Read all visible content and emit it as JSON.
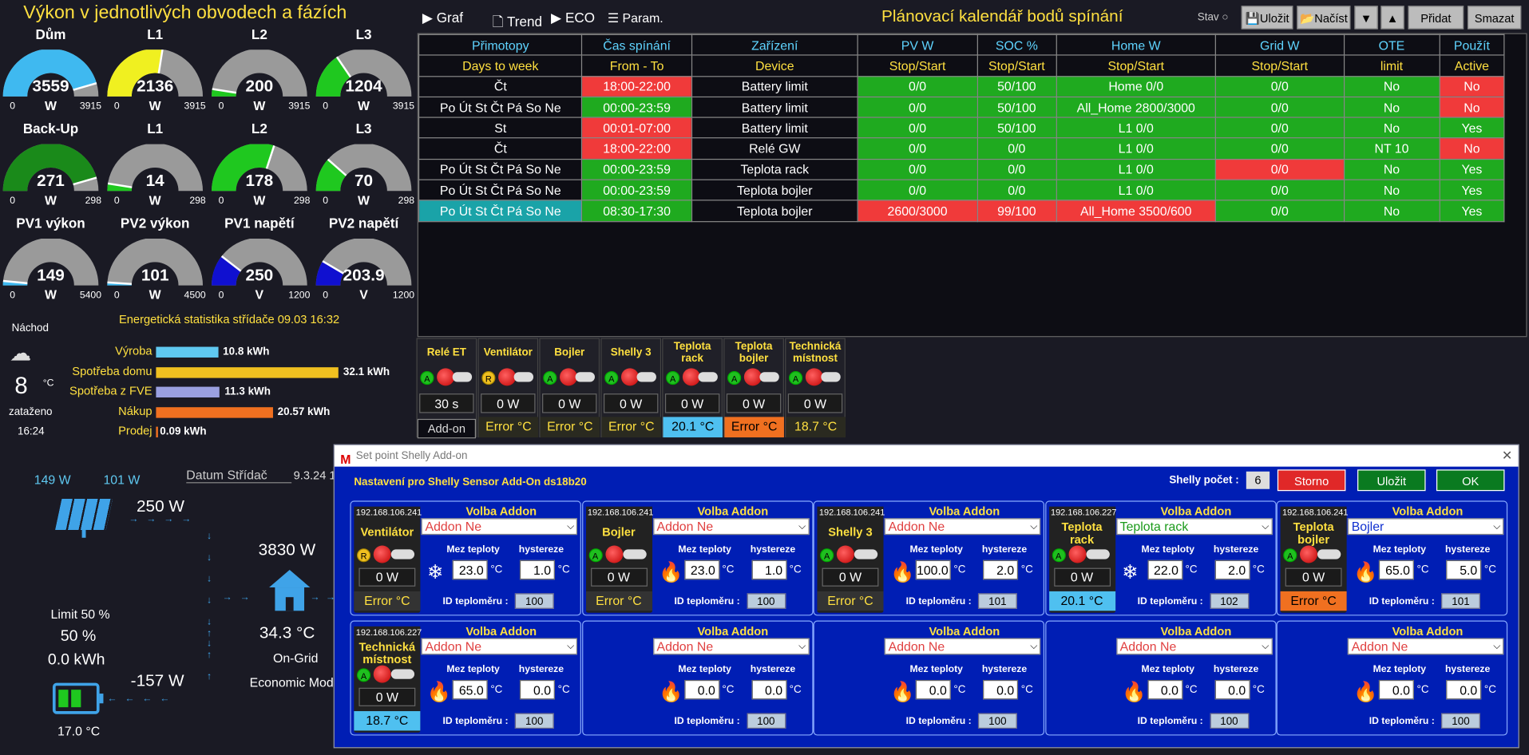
{
  "header": {
    "title": "Výkon v jednotlivých obvodech a fázích",
    "calendar_title": "Plánovací kalendář bodů spínání",
    "stav_label": "Stav"
  },
  "toolbar": {
    "graf": "Graf",
    "trend": "Trend",
    "eco": "ECO",
    "param": "Param.",
    "ulozit": "Uložit",
    "nacist": "Načíst",
    "pridat": "Přidat",
    "smazat": "Smazat"
  },
  "gauges": [
    {
      "title": "Dům",
      "value": "3559",
      "unit": "W",
      "min": "0",
      "max": "3915",
      "color": "#3fb9f0",
      "fraction": 0.91
    },
    {
      "title": "L1",
      "value": "2136",
      "unit": "W",
      "min": "0",
      "max": "3915",
      "color": "#f0f020",
      "fraction": 0.55
    },
    {
      "title": "L2",
      "value": "200",
      "unit": "W",
      "min": "0",
      "max": "3915",
      "color": "#1fc81f",
      "fraction": 0.05
    },
    {
      "title": "L3",
      "value": "1204",
      "unit": "W",
      "min": "0",
      "max": "3915",
      "color": "#1fc81f",
      "fraction": 0.31
    },
    {
      "title": "Back-Up",
      "value": "271",
      "unit": "W",
      "min": "0",
      "max": "298",
      "color": "#1a8a1a",
      "fraction": 0.91
    },
    {
      "title": "L1",
      "value": "14",
      "unit": "W",
      "min": "0",
      "max": "298",
      "color": "#1fc81f",
      "fraction": 0.05
    },
    {
      "title": "L2",
      "value": "178",
      "unit": "W",
      "min": "0",
      "max": "298",
      "color": "#1fc81f",
      "fraction": 0.6
    },
    {
      "title": "L3",
      "value": "70",
      "unit": "W",
      "min": "0",
      "max": "298",
      "color": "#1fc81f",
      "fraction": 0.23
    },
    {
      "title": "PV1 výkon",
      "value": "149",
      "unit": "W",
      "min": "0",
      "max": "5400",
      "color": "#3fb9f0",
      "fraction": 0.03
    },
    {
      "title": "PV2 výkon",
      "value": "101",
      "unit": "W",
      "min": "0",
      "max": "4500",
      "color": "#3fb9f0",
      "fraction": 0.02
    },
    {
      "title": "PV1 napětí",
      "value": "250",
      "unit": "V",
      "min": "0",
      "max": "1200",
      "color": "#1010d0",
      "fraction": 0.21
    },
    {
      "title": "PV2 napětí",
      "value": "203.9",
      "unit": "V",
      "min": "0",
      "max": "1200",
      "color": "#1010d0",
      "fraction": 0.17
    }
  ],
  "weather": {
    "location": "Náchod",
    "temp": "8",
    "unit": "°C",
    "desc": "zataženo",
    "time": "16:24"
  },
  "stats": {
    "title": "Energetická statistika střídače 09.03 16:32",
    "rows": [
      {
        "label": "Výroba",
        "value": "10.8 kWh",
        "color": "#5fc8f0",
        "fraction": 0.34
      },
      {
        "label": "Spotřeba domu",
        "value": "32.1 kWh",
        "color": "#f0c020",
        "fraction": 1.0
      },
      {
        "label": "Spotřeba z FVE",
        "value": "11.3 kWh",
        "color": "#9aa0e0",
        "fraction": 0.35
      },
      {
        "label": "Nákup",
        "value": "20.57 kWh",
        "color": "#f07020",
        "fraction": 0.64
      },
      {
        "label": "Prodej",
        "value": "0.09 kWh",
        "color": "#f07020",
        "fraction": 0.0
      }
    ]
  },
  "schedule": {
    "headers1": [
      "Přimotopy",
      "Čas spínání",
      "Zařízení",
      "PV W",
      "SOC %",
      "Home W",
      "Grid W",
      "OTE",
      "Použít"
    ],
    "headers2": [
      "Days to week",
      "From - To",
      "Device",
      "Stop/Start",
      "Stop/Start",
      "Stop/Start",
      "Stop/Start",
      "limit",
      "Active"
    ],
    "rows": [
      {
        "cells": [
          "Čt",
          "18:00-22:00",
          "Battery limit",
          "0/0",
          "50/100",
          "Home 0/0",
          "0/0",
          "No",
          "No"
        ],
        "bg": [
          "k",
          "r",
          "k",
          "g",
          "g",
          "g",
          "g",
          "g",
          "r"
        ]
      },
      {
        "cells": [
          "Po Út St Čt Pá So Ne",
          "00:00-23:59",
          "Battery limit",
          "0/0",
          "50/100",
          "All_Home 2800/3000",
          "0/0",
          "No",
          "No"
        ],
        "bg": [
          "k",
          "g",
          "k",
          "g",
          "g",
          "g",
          "g",
          "g",
          "r"
        ]
      },
      {
        "cells": [
          "St",
          "00:01-07:00",
          "Battery limit",
          "0/0",
          "50/100",
          "L1 0/0",
          "0/0",
          "No",
          "Yes"
        ],
        "bg": [
          "k",
          "r",
          "k",
          "g",
          "g",
          "g",
          "g",
          "g",
          "g"
        ]
      },
      {
        "cells": [
          "Čt",
          "18:00-22:00",
          "Relé GW",
          "0/0",
          "0/0",
          "L1 0/0",
          "0/0",
          "NT 10",
          "No"
        ],
        "bg": [
          "k",
          "r",
          "k",
          "g",
          "g",
          "g",
          "g",
          "g",
          "r"
        ]
      },
      {
        "cells": [
          "Po Út St Čt Pá So Ne",
          "00:00-23:59",
          "Teplota rack",
          "0/0",
          "0/0",
          "L1 0/0",
          "0/0",
          "No",
          "Yes"
        ],
        "bg": [
          "k",
          "g",
          "k",
          "g",
          "g",
          "g",
          "r",
          "g",
          "g"
        ]
      },
      {
        "cells": [
          "Po Út St Čt Pá So Ne",
          "00:00-23:59",
          "Teplota bojler",
          "0/0",
          "0/0",
          "L1 0/0",
          "0/0",
          "No",
          "Yes"
        ],
        "bg": [
          "k",
          "g",
          "k",
          "g",
          "g",
          "g",
          "g",
          "g",
          "g"
        ]
      },
      {
        "cells": [
          "Po Út St Čt Pá So Ne",
          "08:30-17:30",
          "Teplota bojler",
          "2600/3000",
          "99/100",
          "All_Home 3500/600",
          "0/0",
          "No",
          "Yes"
        ],
        "bg": [
          "c",
          "g",
          "k",
          "r",
          "r",
          "r",
          "g",
          "g",
          "g"
        ]
      }
    ]
  },
  "devices": [
    {
      "name": "Relé ET",
      "led": "A",
      "value": "30 s",
      "temp": ""
    },
    {
      "name": "Ventilátor",
      "led": "R",
      "value": "0 W",
      "temp": "Error °C"
    },
    {
      "name": "Bojler",
      "led": "A",
      "value": "0 W",
      "temp": "Error °C"
    },
    {
      "name": "Shelly 3",
      "led": "A",
      "value": "0 W",
      "temp": "Error °C"
    },
    {
      "name": "Teplota rack",
      "led": "A",
      "value": "0 W",
      "temp": "20.1 °C"
    },
    {
      "name": "Teplota bojler",
      "led": "A",
      "value": "0 W",
      "temp": "Error °C"
    },
    {
      "name": "Technická místnost",
      "led": "A",
      "value": "0 W",
      "temp": "18.7 °C"
    }
  ],
  "addon_tab": "Add-on",
  "flow": {
    "pv1": "149 W",
    "pv2": "101 W",
    "pv_total": "250 W",
    "house": "3830 W",
    "temp": "34.3 °C",
    "mode1": "On-Grid",
    "mode2": "Economic Mod",
    "limit_label": "Limit 50 %",
    "limit": "50 %",
    "energy": "0.0 kWh",
    "battery": "-157 W",
    "bat_temp": "17.0 °C",
    "datum_label": "Datum Střídač",
    "version": "9.3.24 1"
  },
  "dialog": {
    "title": "Set point Shelly Add-on",
    "heading": "Nastavení pro Shelly Sensor Add-On ds18b20",
    "count_label": "Shelly počet :",
    "count": "6",
    "storno": "Storno",
    "ulozit": "Uložit",
    "ok": "OK",
    "labels": {
      "volba": "Volba Addon",
      "mez": "Mez teploty",
      "hyst": "hystereze",
      "id": "ID teploměru :",
      "unit": "°C"
    },
    "cards": [
      {
        "ip": "192.168.106.241",
        "name": "Ventilátor",
        "led": "R",
        "value": "0 W",
        "temp": "Error °C",
        "addon": "Addon Ne",
        "mez": "23.0",
        "hyst": "1.0",
        "id": "100",
        "icon": "snow"
      },
      {
        "ip": "192.168.106.241",
        "name": "Bojler",
        "led": "A",
        "value": "0 W",
        "temp": "Error °C",
        "addon": "Addon Ne",
        "mez": "23.0",
        "hyst": "1.0",
        "id": "100",
        "icon": "fire"
      },
      {
        "ip": "192.168.106.241",
        "name": "Shelly 3",
        "led": "A",
        "value": "0 W",
        "temp": "Error °C",
        "addon": "Addon Ne",
        "mez": "100.0",
        "hyst": "2.0",
        "id": "101",
        "icon": "fire"
      },
      {
        "ip": "192.168.106.227",
        "name": "Teplota rack",
        "led": "A",
        "value": "0 W",
        "temp": "20.1 °C",
        "addon": "Teplota rack",
        "mez": "22.0",
        "hyst": "2.0",
        "id": "102",
        "icon": "snow"
      },
      {
        "ip": "192.168.106.241",
        "name": "Teplota bojler",
        "led": "A",
        "value": "0 W",
        "temp": "Error °C",
        "addon": "Bojler",
        "mez": "65.0",
        "hyst": "5.0",
        "id": "101",
        "icon": "fire"
      },
      {
        "ip": "192.168.106.227",
        "name": "Technická místnost",
        "led": "A",
        "value": "0 W",
        "temp": "18.7 °C",
        "addon": "Addon Ne",
        "mez": "65.0",
        "hyst": "0.0",
        "id": "100",
        "icon": "fire"
      },
      {
        "ip": "",
        "name": "",
        "led": "",
        "value": "",
        "temp": "",
        "addon": "Addon Ne",
        "mez": "0.0",
        "hyst": "0.0",
        "id": "100",
        "icon": "fire"
      },
      {
        "ip": "",
        "name": "",
        "led": "",
        "value": "",
        "temp": "",
        "addon": "Addon Ne",
        "mez": "0.0",
        "hyst": "0.0",
        "id": "100",
        "icon": "fire"
      },
      {
        "ip": "",
        "name": "",
        "led": "",
        "value": "",
        "temp": "",
        "addon": "Addon Ne",
        "mez": "0.0",
        "hyst": "0.0",
        "id": "100",
        "icon": "fire"
      },
      {
        "ip": "",
        "name": "",
        "led": "",
        "value": "",
        "temp": "",
        "addon": "Addon Ne",
        "mez": "0.0",
        "hyst": "0.0",
        "id": "100",
        "icon": "fire"
      }
    ]
  }
}
